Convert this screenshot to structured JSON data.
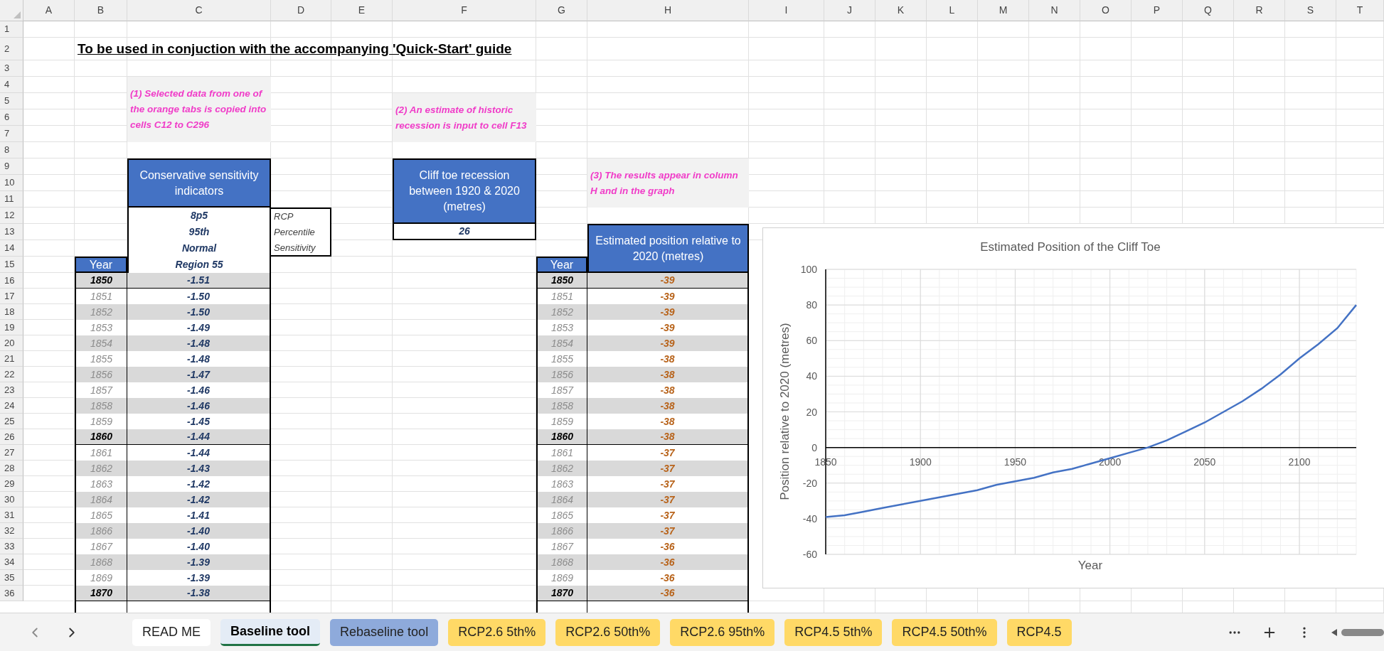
{
  "column_headers": [
    "A",
    "B",
    "C",
    "D",
    "E",
    "F",
    "G",
    "H",
    "I",
    "J",
    "K",
    "L",
    "M",
    "N",
    "O",
    "P",
    "Q",
    "R",
    "S",
    "T"
  ],
  "row_headers": [
    "1",
    "2",
    "3",
    "4",
    "5",
    "6",
    "7",
    "8",
    "9",
    "10",
    "11",
    "12",
    "13",
    "14",
    "15",
    "16",
    "17",
    "18",
    "19",
    "20",
    "21",
    "22",
    "23",
    "24",
    "25",
    "26",
    "27",
    "28",
    "29",
    "30",
    "31",
    "32",
    "33",
    "34",
    "35",
    "36"
  ],
  "title": "To be used in conjuction with the accompanying 'Quick-Start' guide",
  "notes": [
    "(1) Selected data from one of the orange tabs is copied into cells C12 to C296",
    "(2) An estimate of historic recession is input to cell F13",
    "(3) The results appear in column H and in the graph"
  ],
  "indicators": {
    "header": "Conservative sensitivity indicators",
    "rows": [
      {
        "value": "8p5",
        "label": "RCP"
      },
      {
        "value": "95th",
        "label": "Percentile"
      },
      {
        "value": "Normal",
        "label": "Sensitivity"
      },
      {
        "value": "Region 55"
      }
    ]
  },
  "recession": {
    "header": "Cliff toe recession between 1920 & 2020 (metres)",
    "value": "26"
  },
  "input_table": {
    "year_header": "Year",
    "rows": [
      {
        "year": "1850",
        "value": "-1.51",
        "kind": "decade"
      },
      {
        "year": "1851",
        "value": "-1.50",
        "kind": "year"
      },
      {
        "year": "1852",
        "value": "-1.50",
        "kind": "year"
      },
      {
        "year": "1853",
        "value": "-1.49",
        "kind": "year"
      },
      {
        "year": "1854",
        "value": "-1.48",
        "kind": "year"
      },
      {
        "year": "1855",
        "value": "-1.48",
        "kind": "year"
      },
      {
        "year": "1856",
        "value": "-1.47",
        "kind": "year"
      },
      {
        "year": "1857",
        "value": "-1.46",
        "kind": "year"
      },
      {
        "year": "1858",
        "value": "-1.46",
        "kind": "year"
      },
      {
        "year": "1859",
        "value": "-1.45",
        "kind": "year"
      },
      {
        "year": "1860",
        "value": "-1.44",
        "kind": "decade"
      },
      {
        "year": "1861",
        "value": "-1.44",
        "kind": "year"
      },
      {
        "year": "1862",
        "value": "-1.43",
        "kind": "year"
      },
      {
        "year": "1863",
        "value": "-1.42",
        "kind": "year"
      },
      {
        "year": "1864",
        "value": "-1.42",
        "kind": "year"
      },
      {
        "year": "1865",
        "value": "-1.41",
        "kind": "year"
      },
      {
        "year": "1866",
        "value": "-1.40",
        "kind": "year"
      },
      {
        "year": "1867",
        "value": "-1.40",
        "kind": "year"
      },
      {
        "year": "1868",
        "value": "-1.39",
        "kind": "year"
      },
      {
        "year": "1869",
        "value": "-1.39",
        "kind": "year"
      },
      {
        "year": "1870",
        "value": "-1.38",
        "kind": "decade"
      }
    ]
  },
  "results_table": {
    "year_header": "Year",
    "value_header": "Estimated position relative to 2020 (metres)",
    "rows": [
      {
        "year": "1850",
        "value": "-39",
        "kind": "decade"
      },
      {
        "year": "1851",
        "value": "-39",
        "kind": "year"
      },
      {
        "year": "1852",
        "value": "-39",
        "kind": "year"
      },
      {
        "year": "1853",
        "value": "-39",
        "kind": "year"
      },
      {
        "year": "1854",
        "value": "-39",
        "kind": "year"
      },
      {
        "year": "1855",
        "value": "-38",
        "kind": "year"
      },
      {
        "year": "1856",
        "value": "-38",
        "kind": "year"
      },
      {
        "year": "1857",
        "value": "-38",
        "kind": "year"
      },
      {
        "year": "1858",
        "value": "-38",
        "kind": "year"
      },
      {
        "year": "1859",
        "value": "-38",
        "kind": "year"
      },
      {
        "year": "1860",
        "value": "-38",
        "kind": "decade"
      },
      {
        "year": "1861",
        "value": "-37",
        "kind": "year"
      },
      {
        "year": "1862",
        "value": "-37",
        "kind": "year"
      },
      {
        "year": "1863",
        "value": "-37",
        "kind": "year"
      },
      {
        "year": "1864",
        "value": "-37",
        "kind": "year"
      },
      {
        "year": "1865",
        "value": "-37",
        "kind": "year"
      },
      {
        "year": "1866",
        "value": "-37",
        "kind": "year"
      },
      {
        "year": "1867",
        "value": "-36",
        "kind": "year"
      },
      {
        "year": "1868",
        "value": "-36",
        "kind": "year"
      },
      {
        "year": "1869",
        "value": "-36",
        "kind": "year"
      },
      {
        "year": "1870",
        "value": "-36",
        "kind": "decade"
      }
    ]
  },
  "chart": {
    "chart_data": {
      "type": "line",
      "grid": true,
      "title": "Estimated Position of the Cliff Toe",
      "xlabel": "Year",
      "ylabel": "Position relative to 2020 (metres)",
      "x": [
        1850,
        1860,
        1870,
        1880,
        1890,
        1900,
        1910,
        1920,
        1930,
        1940,
        1950,
        1960,
        1970,
        1980,
        1990,
        2000,
        2010,
        2020,
        2030,
        2040,
        2050,
        2060,
        2070,
        2080,
        2090,
        2100,
        2110,
        2120,
        2130
      ],
      "series": [
        {
          "color": "#4472c4",
          "values": [
            -39,
            -38,
            -36,
            -34,
            -32,
            -30,
            -28,
            -26,
            -24,
            -21,
            -19,
            -17,
            -14,
            -12,
            -9,
            -6,
            -3,
            0,
            4,
            9,
            14,
            20,
            26,
            33,
            41,
            50,
            58,
            67,
            80
          ]
        }
      ],
      "xlim": [
        1850,
        2130
      ],
      "ylim": [
        -60,
        100
      ],
      "xticks": [
        1850,
        1900,
        1950,
        2000,
        2050,
        2100
      ],
      "yticks": [
        -60,
        -40,
        -20,
        0,
        20,
        40,
        60,
        80,
        100
      ]
    }
  },
  "sheet_tabs": [
    {
      "label": "READ ME",
      "selected": false,
      "color": "#ffffff"
    },
    {
      "label": "Baseline tool",
      "selected": true,
      "color": "#e4ecf6"
    },
    {
      "label": "Rebaseline tool",
      "selected": false,
      "color": "#8eaadb"
    },
    {
      "label": "RCP2.6 5th%",
      "selected": false,
      "color": "#ffd966"
    },
    {
      "label": "RCP2.6 50th%",
      "selected": false,
      "color": "#ffd966"
    },
    {
      "label": "RCP2.6 95th%",
      "selected": false,
      "color": "#ffd966"
    },
    {
      "label": "RCP4.5 5th%",
      "selected": false,
      "color": "#ffd966"
    },
    {
      "label": "RCP4.5 50th%",
      "selected": false,
      "color": "#ffd966"
    },
    {
      "label": "RCP4.5",
      "selected": false,
      "color": "#ffd966"
    }
  ]
}
